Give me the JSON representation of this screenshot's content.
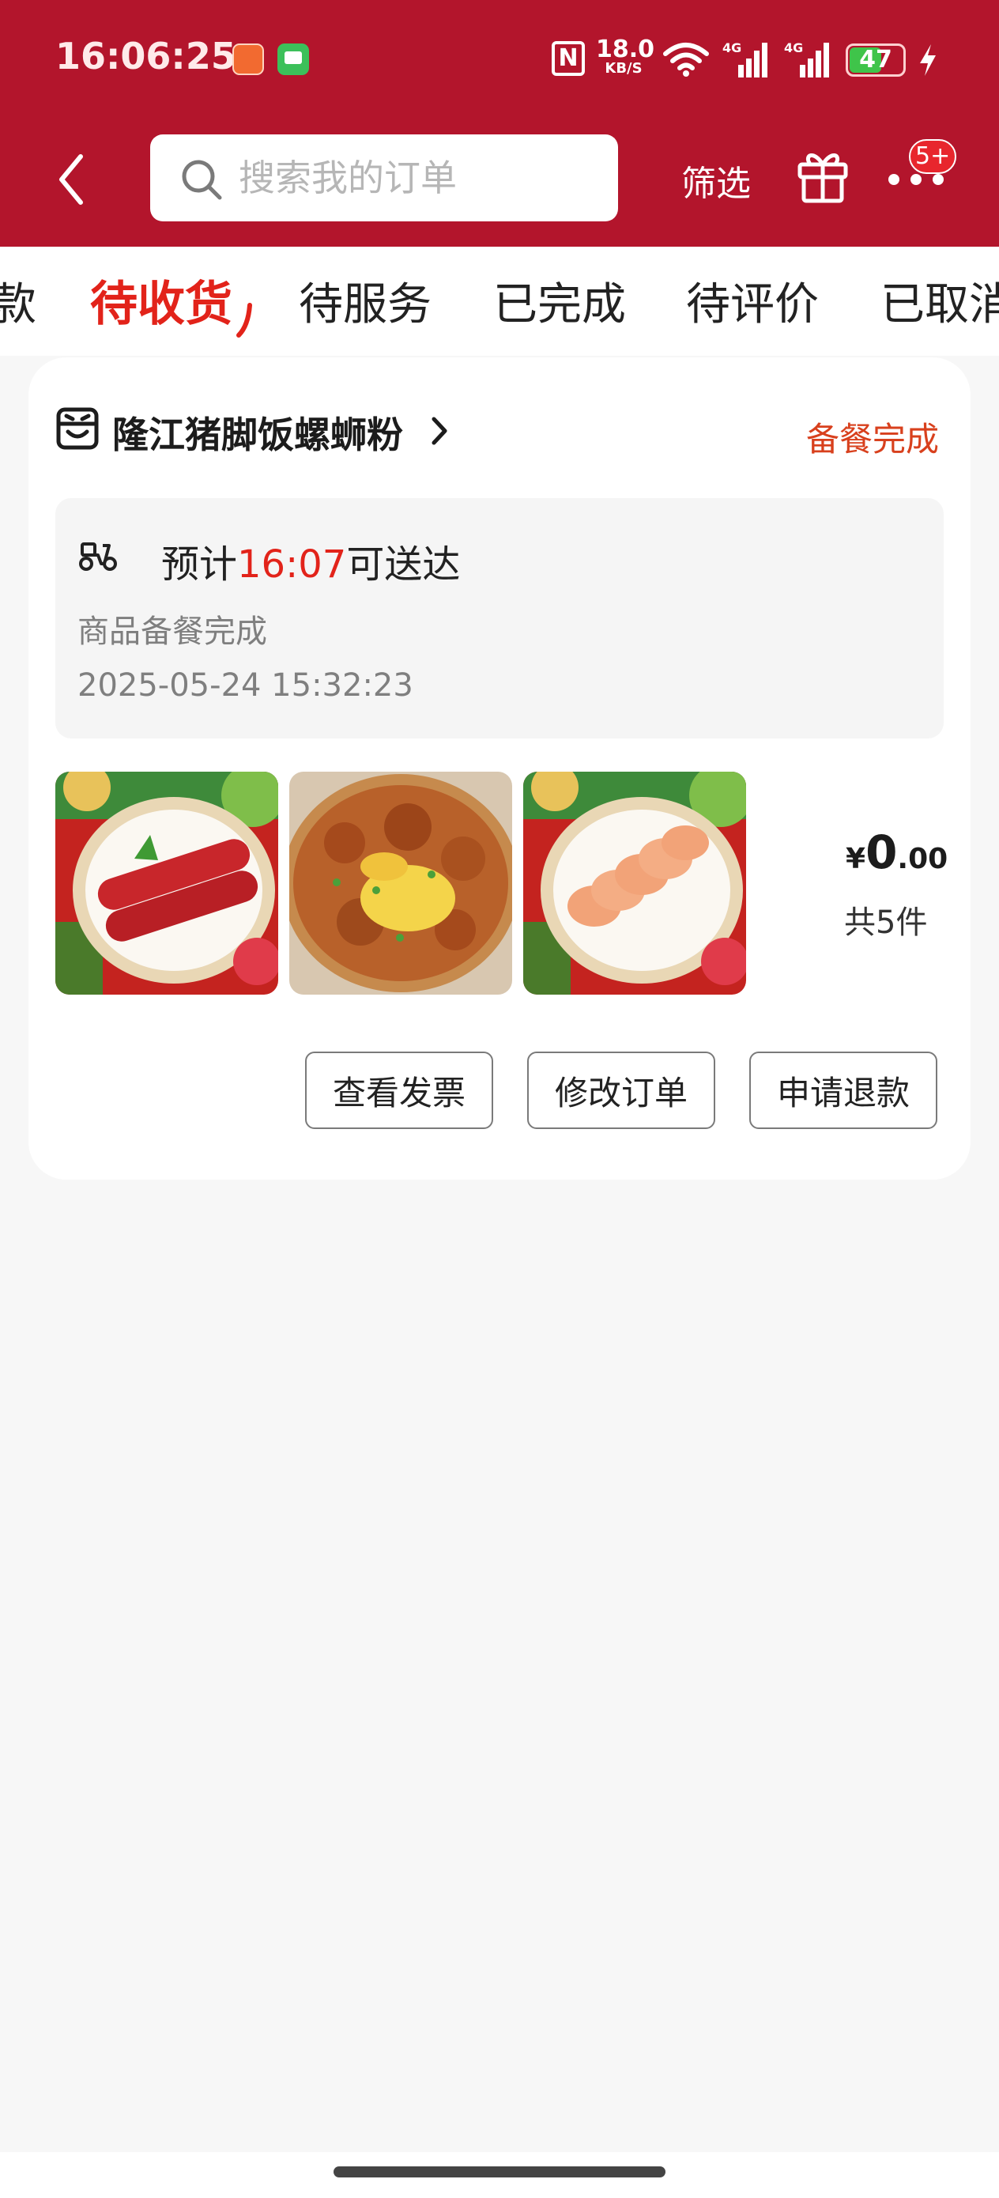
{
  "status_bar": {
    "time": "16:06:25",
    "nfc": "N",
    "speed_value": "18.0",
    "speed_unit": "KB/S",
    "network1": "4G",
    "network2": "4G",
    "battery": "47"
  },
  "header": {
    "search_placeholder": "搜索我的订单",
    "filter_label": "筛选",
    "more_badge": "5+"
  },
  "tabs": [
    {
      "label": "款"
    },
    {
      "label": "待收货"
    },
    {
      "label": "待服务"
    },
    {
      "label": "已完成"
    },
    {
      "label": "待评价"
    },
    {
      "label": "已取消"
    }
  ],
  "order": {
    "shop_name": "隆江猪脚饭螺蛳粉",
    "status": "备餐完成",
    "delivery": {
      "eta_prefix": "预计",
      "eta_time": "16:07",
      "eta_suffix": "可送达",
      "detail": "商品备餐完成",
      "timestamp": "2025-05-24 15:32:23"
    },
    "price_symbol": "¥",
    "price_int": "0",
    "price_dec": ".00",
    "item_count": "共5件",
    "actions": [
      {
        "label": "查看发票"
      },
      {
        "label": "修改订单"
      },
      {
        "label": "申请退款"
      }
    ]
  },
  "colors": {
    "header_bg": "#b3152c",
    "accent": "#e2231a",
    "status_text": "#d8401d"
  }
}
